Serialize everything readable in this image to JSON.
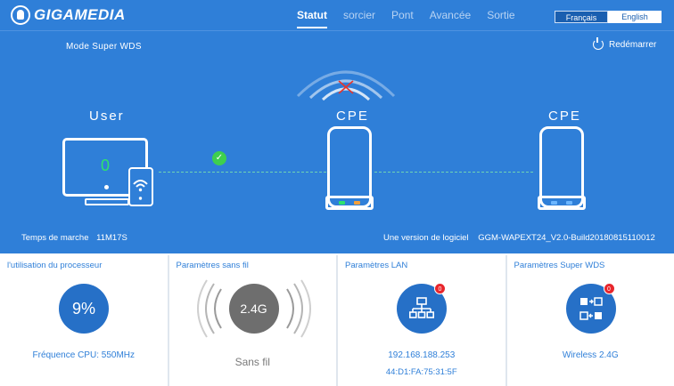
{
  "brand": {
    "name": "GIGAMEDIA"
  },
  "nav": {
    "items": [
      {
        "label": "Statut",
        "active": true
      },
      {
        "label": "sorcier",
        "active": false
      },
      {
        "label": "Pont",
        "active": false
      },
      {
        "label": "Avancée",
        "active": false
      },
      {
        "label": "Sortie",
        "active": false
      }
    ]
  },
  "language": {
    "options": [
      "Français",
      "English"
    ],
    "selected": "Français"
  },
  "status": {
    "mode": "Mode  Super  WDS",
    "reboot_label": "Redémarrer",
    "user_label": "User",
    "user_count": "0",
    "cpe_local_label": "CPE",
    "cpe_remote_label": "CPE",
    "uptime_label": "Temps de marche",
    "uptime_value": "11M17S",
    "firmware_label": "Une version de logiciel",
    "firmware_value": "GGM-WAPEXT24_V2.0-Build20180815110012"
  },
  "cards": {
    "cpu": {
      "title": "l'utilisation du processeur",
      "value": "9%",
      "footer": "Fréquence CPU: 550MHz"
    },
    "wireless": {
      "title": "Paramètres sans fil",
      "band": "2.4G",
      "footer": "Sans fil"
    },
    "lan": {
      "title": "Paramètres LAN",
      "badge": "0",
      "ip": "192.168.188.253",
      "mac": "44:D1:FA:75:31:5F"
    },
    "wds": {
      "title": "Paramètres Super WDS",
      "badge": "0",
      "footer": "Wireless 2.4G"
    }
  },
  "colors": {
    "header_bg": "#2f7fd8",
    "accent": "#2670c7",
    "ok": "#3ecf4e",
    "badge": "#e8262c",
    "led_green": "#2ee36d",
    "led_orange": "#f4a03a",
    "led_blue": "#6cb6ff"
  },
  "icons": [
    "logo-icon",
    "power-icon",
    "wifi-signal-icon",
    "disconnected-icon",
    "monitor-icon",
    "phone-wifi-icon",
    "check-icon",
    "cpe-device-icon",
    "wifi-waves-icon",
    "network-tree-icon",
    "wds-switch-icon"
  ]
}
